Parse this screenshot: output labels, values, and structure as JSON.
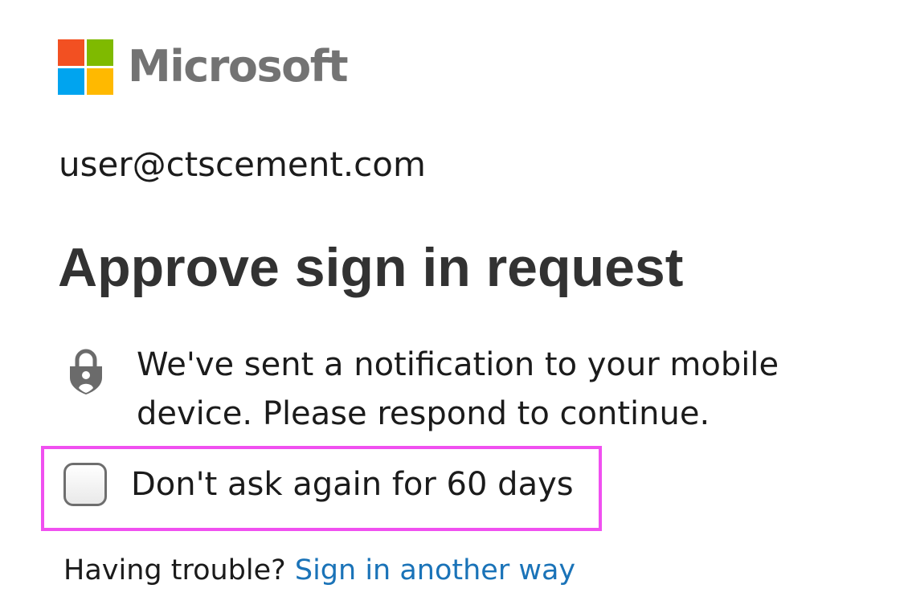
{
  "brand": {
    "name": "Microsoft",
    "colors": {
      "red": "#f25022",
      "green": "#7fba00",
      "blue": "#00a4ef",
      "yellow": "#ffb900",
      "text": "#737373"
    }
  },
  "account": {
    "email": "user@ctscement.com"
  },
  "page": {
    "title": "Approve sign in request"
  },
  "notice": {
    "icon": "lock-shield-icon",
    "text": "We've sent a notification to your mobile device. Please respond to continue."
  },
  "remember": {
    "label": "Don't ask again for 60 days",
    "checked": false,
    "highlight_color": "#f050f0"
  },
  "help": {
    "prompt": "Having trouble?",
    "link_label": "Sign in another way",
    "link_color": "#1a73b8"
  }
}
